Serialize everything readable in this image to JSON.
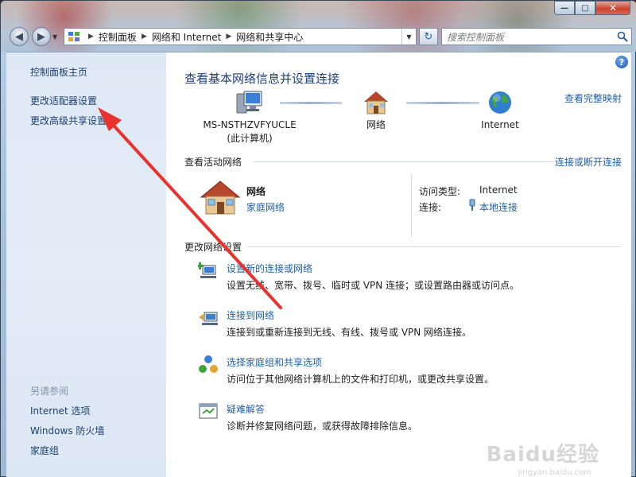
{
  "window": {
    "minimize": "—",
    "maximize": "□",
    "close": "✕"
  },
  "address_bar": {
    "crumbs": [
      "控制面板",
      "网络和 Internet",
      "网络和共享中心"
    ],
    "search_placeholder": "搜索控制面板"
  },
  "sidebar": {
    "links": [
      "控制面板主页",
      "更改适配器设置",
      "更改高级共享设置"
    ],
    "see_also_heading": "另请参阅",
    "see_also": [
      "Internet 选项",
      "Windows 防火墙",
      "家庭组"
    ]
  },
  "main": {
    "title": "查看基本网络信息并设置连接",
    "full_map_link": "查看完整映射",
    "nodes": [
      {
        "label": "MS-NSTHZVFYUCLE",
        "sub": "(此计算机)"
      },
      {
        "label": "网络"
      },
      {
        "label": "Internet"
      }
    ],
    "active_section": "查看活动网络",
    "connect_disconnect_link": "连接或断开连接",
    "active_network": {
      "name": "网络",
      "type": "家庭网络",
      "access_type_label": "访问类型:",
      "access_type_value": "Internet",
      "connection_label": "连接:",
      "connection_value": "本地连接"
    },
    "change_section": "更改网络设置",
    "tasks": [
      {
        "title": "设置新的连接或网络",
        "desc": "设置无线、宽带、拨号、临时或 VPN 连接；或设置路由器或访问点。"
      },
      {
        "title": "连接到网络",
        "desc": "连接到或重新连接到无线、有线、拨号或 VPN 网络连接。"
      },
      {
        "title": "选择家庭组和共享选项",
        "desc": "访问位于其他网络计算机上的文件和打印机，或更改共享设置。"
      },
      {
        "title": "疑难解答",
        "desc": "诊断并修复网络问题，或获得故障排除信息。"
      }
    ]
  },
  "watermark": {
    "brand": "Baidu经验",
    "url": "jingyan.baidu.com"
  },
  "colors": {
    "link": "#1f5fa8",
    "title": "#1e3e78",
    "annotation_arrow": "#e8322d"
  }
}
